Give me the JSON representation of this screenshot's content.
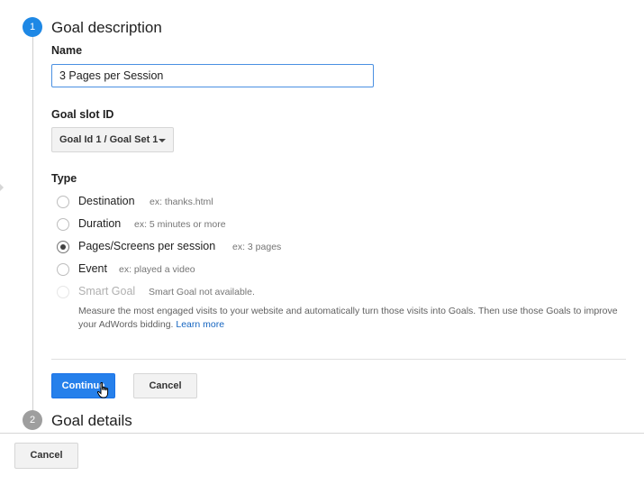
{
  "steps": [
    {
      "number": "1",
      "title": "Goal description"
    },
    {
      "number": "2",
      "title": "Goal details"
    }
  ],
  "form": {
    "name_label": "Name",
    "name_value": "3 Pages per Session",
    "slot_label": "Goal slot ID",
    "slot_value": "Goal Id 1 / Goal Set 1",
    "type_label": "Type",
    "types": [
      {
        "label": "Destination",
        "hint": "ex: thanks.html",
        "checked": false
      },
      {
        "label": "Duration",
        "hint": "ex: 5 minutes or more",
        "checked": false
      },
      {
        "label": "Pages/Screens per session",
        "hint": "ex: 3 pages",
        "checked": true
      },
      {
        "label": "Event",
        "hint": "ex: played a video",
        "checked": false
      },
      {
        "label": "Smart Goal",
        "hint": "Smart Goal not available.",
        "checked": false,
        "disabled": true
      }
    ],
    "smart_goal_description": "Measure the most engaged visits to your website and automatically turn those visits into Goals. Then use those Goals to improve your AdWords bidding.",
    "learn_more": "Learn more"
  },
  "buttons": {
    "continue": "Continue",
    "cancel": "Cancel",
    "cancel_bottom": "Cancel"
  },
  "colors": {
    "step_active": "#1e88e5",
    "step_inactive": "#9e9e9e",
    "primary_button": "#2680eb",
    "link": "#1565c0"
  },
  "icons": {
    "cursor": "hand-pointer-icon",
    "dropdown": "caret-down-icon"
  }
}
